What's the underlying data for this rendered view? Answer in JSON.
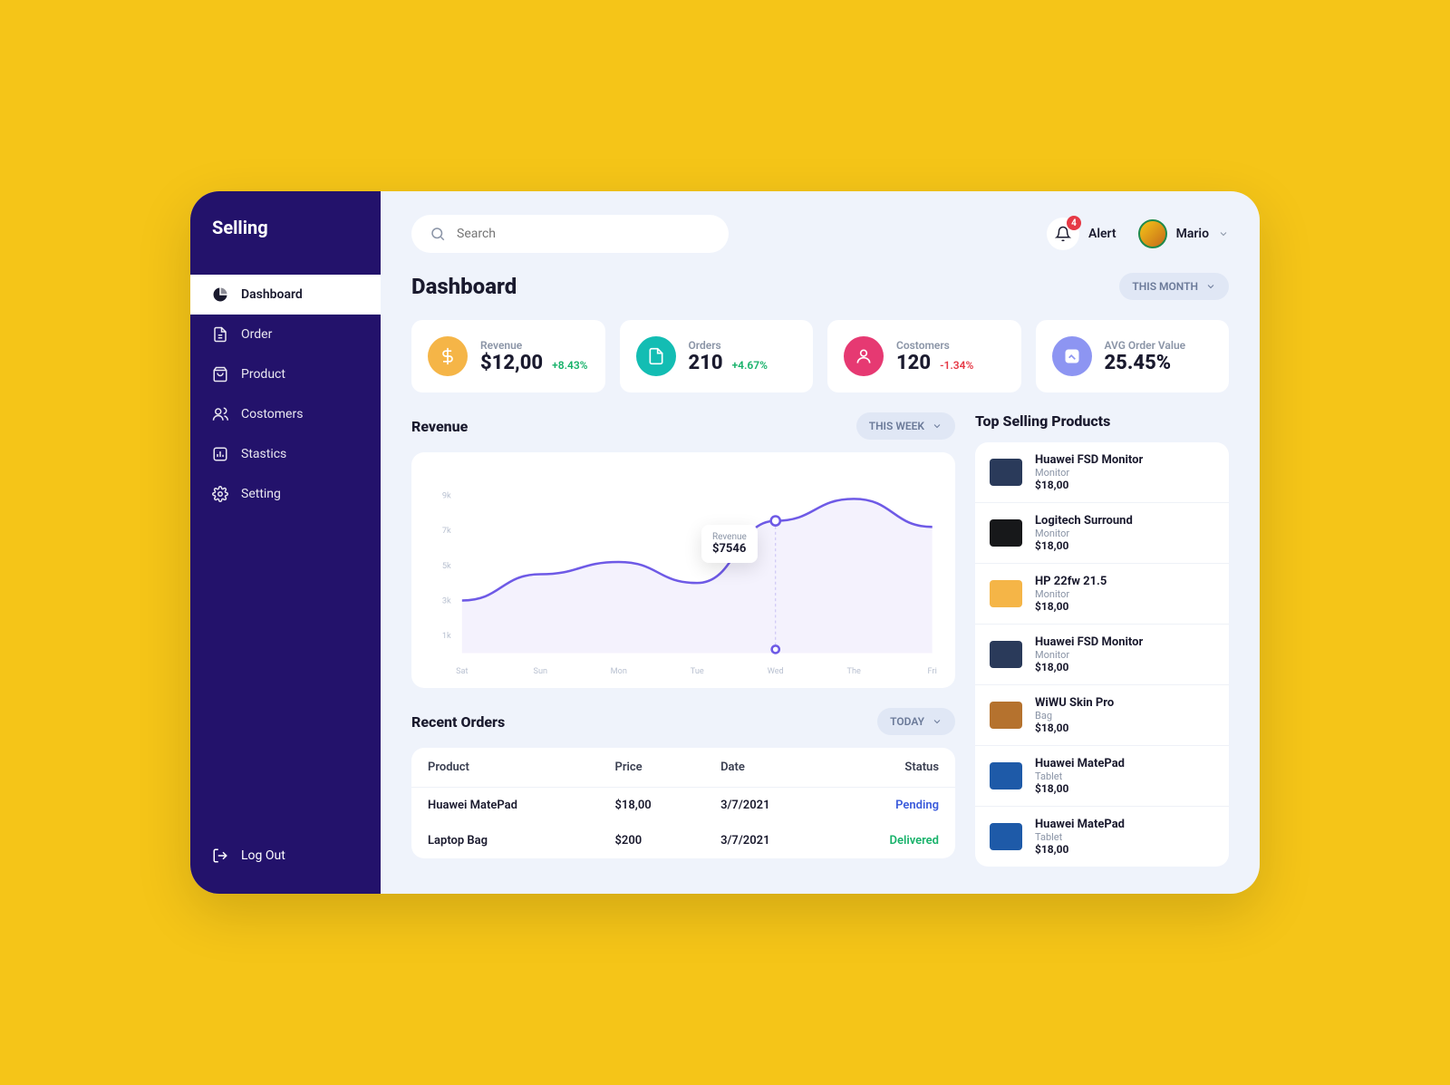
{
  "brand": "Selling",
  "search": {
    "placeholder": "Search"
  },
  "alert": {
    "count": "4",
    "label": "Alert"
  },
  "user": {
    "name": "Mario"
  },
  "nav": [
    {
      "label": "Dashboard",
      "active": true
    },
    {
      "label": "Order"
    },
    {
      "label": "Product"
    },
    {
      "label": "Costomers"
    },
    {
      "label": "Stastics"
    },
    {
      "label": "Setting"
    }
  ],
  "logout": "Log Out",
  "page": {
    "title": "Dashboard",
    "rangeLabel": "THIS MONTH"
  },
  "stats": [
    {
      "label": "Revenue",
      "value": "$12,00",
      "delta": "+8.43%",
      "deltaSign": "pos",
      "color": "#f5b547"
    },
    {
      "label": "Orders",
      "value": "210",
      "delta": "+4.67%",
      "deltaSign": "pos",
      "color": "#13bdb3"
    },
    {
      "label": "Costomers",
      "value": "120",
      "delta": "-1.34%",
      "deltaSign": "neg",
      "color": "#e63972"
    },
    {
      "label": "AVG Order Value",
      "value": "25.45%",
      "delta": "",
      "deltaSign": "",
      "color": "#8d95f2"
    }
  ],
  "revenue": {
    "title": "Revenue",
    "rangeLabel": "THIS WEEK",
    "tooltip": {
      "label": "Revenue",
      "value": "$7546"
    }
  },
  "chart_data": {
    "type": "line",
    "categories": [
      "Sat",
      "Sun",
      "Mon",
      "Tue",
      "Wed",
      "The",
      "Fri"
    ],
    "values": [
      3000,
      4500,
      5200,
      4000,
      7546,
      8800,
      7200
    ],
    "yticks": [
      "1k",
      "3k",
      "5k",
      "7k",
      "9k"
    ],
    "ylim": [
      0,
      10000
    ],
    "title": "Revenue",
    "xlabel": "",
    "ylabel": ""
  },
  "recentOrders": {
    "title": "Recent Orders",
    "rangeLabel": "TODAY",
    "columns": [
      "Product",
      "Price",
      "Date",
      "Status"
    ],
    "rows": [
      {
        "product": "Huawei MatePad",
        "price": "$18,00",
        "date": "3/7/2021",
        "status": "Pending",
        "statusClass": "pending"
      },
      {
        "product": "Laptop Bag",
        "price": "$200",
        "date": "3/7/2021",
        "status": "Delivered",
        "statusClass": "delivered"
      }
    ]
  },
  "topProducts": {
    "title": "Top Selling Products",
    "items": [
      {
        "name": "Huawei FSD Monitor",
        "category": "Monitor",
        "price": "$18,00",
        "thumb": "#2a3a5a"
      },
      {
        "name": "Logitech Surround",
        "category": "Monitor",
        "price": "$18,00",
        "thumb": "#17181a"
      },
      {
        "name": "HP 22fw 21.5",
        "category": "Monitor",
        "price": "$18,00",
        "thumb": "#f5b547"
      },
      {
        "name": "Huawei FSD Monitor",
        "category": "Monitor",
        "price": "$18,00",
        "thumb": "#2a3a5a"
      },
      {
        "name": "WiWU Skin Pro",
        "category": "Bag",
        "price": "$18,00",
        "thumb": "#b5722e"
      },
      {
        "name": "Huawei MatePad",
        "category": "Tablet",
        "price": "$18,00",
        "thumb": "#1e5aa8"
      },
      {
        "name": "Huawei MatePad",
        "category": "Tablet",
        "price": "$18,00",
        "thumb": "#1e5aa8"
      }
    ]
  }
}
